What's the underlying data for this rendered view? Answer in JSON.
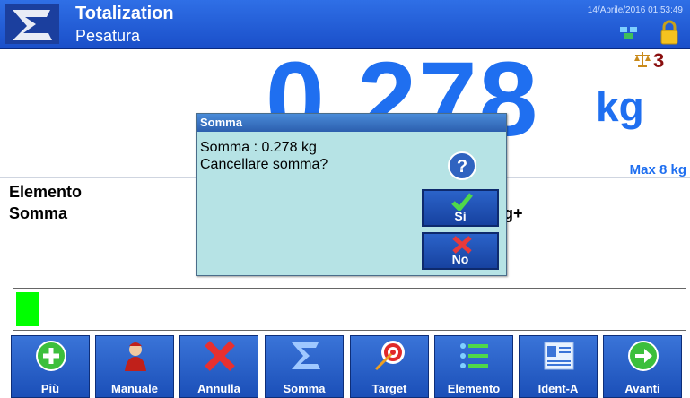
{
  "header": {
    "title": "Totalization",
    "subtitle": "Pesatura",
    "datetime": "14/Aprile/2016 01:53:49"
  },
  "display": {
    "weight": "0.278",
    "unit": "kg",
    "scale_number": "3",
    "max_capacity": "Max 8 kg"
  },
  "labels": {
    "elemento": "Elemento",
    "somma": "Somma",
    "gplus": "g+"
  },
  "progress": {
    "fill_fraction": 0.03,
    "color": "#00ff00"
  },
  "dialog": {
    "title": "Somma",
    "line1": "Somma : 0.278 kg",
    "line2": "Cancellare somma?",
    "yes_label": "Sì",
    "no_label": "No"
  },
  "toolbar": [
    {
      "label": "Più",
      "icon": "plus-icon"
    },
    {
      "label": "Manuale",
      "icon": "operator-icon"
    },
    {
      "label": "Annulla",
      "icon": "cancel-x-icon"
    },
    {
      "label": "Somma",
      "icon": "sigma-icon"
    },
    {
      "label": "Target",
      "icon": "target-icon"
    },
    {
      "label": "Elemento",
      "icon": "list-icon"
    },
    {
      "label": "Ident-A",
      "icon": "id-card-icon"
    },
    {
      "label": "Avanti",
      "icon": "arrow-right-icon"
    }
  ],
  "colors": {
    "header_blue": "#1a4fc9",
    "weight_blue": "#1f6ff0",
    "dialog_bg": "#b6e3e5",
    "button_blue": "#1b4fb8"
  }
}
